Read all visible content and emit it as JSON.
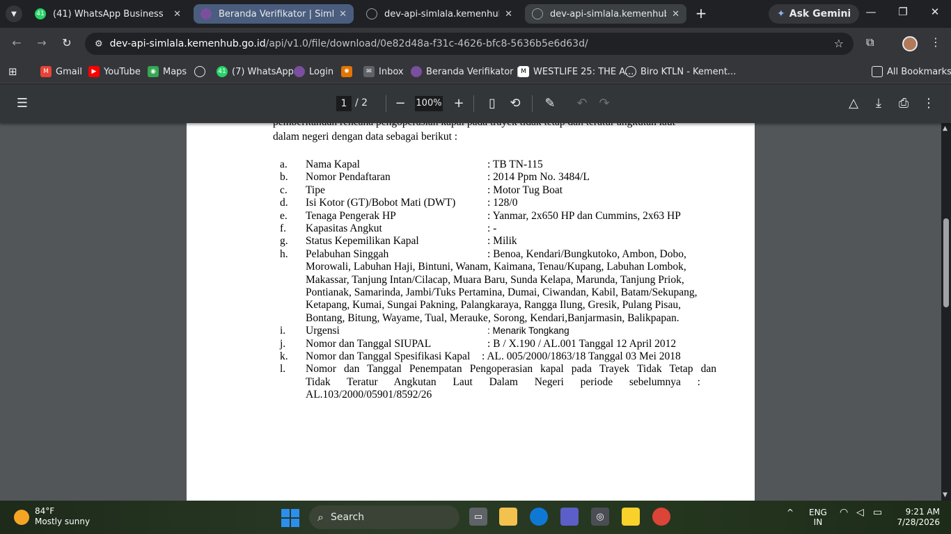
{
  "tabs": [
    {
      "title": "(41) WhatsApp Business",
      "badge": "41",
      "color": "#25d366"
    },
    {
      "title": "Beranda Verifikator | SimLala",
      "color": "#7a4f9e"
    },
    {
      "title": "dev-api-simlala.kemenhub.go.id",
      "color": "#5f6368"
    },
    {
      "title": "dev-api-simlala.kemenhub.go.id",
      "color": "#5f6368"
    }
  ],
  "gemini": "Ask Gemini",
  "url": {
    "host": "dev-api-simlala.kemenhub.go.id",
    "path": "/api/v1.0/file/download/0e82d48a-f31c-4626-bfc8-5636b5e6d63d/"
  },
  "bookmarks": [
    {
      "label": "Gmail",
      "color": "#ea4335",
      "icon": "mail-icon"
    },
    {
      "label": "YouTube",
      "color": "#ff0000",
      "icon": "youtube-icon"
    },
    {
      "label": "Maps",
      "color": "#34a853",
      "icon": "map-pin-icon"
    },
    {
      "label": "",
      "color": "#9aa0a6",
      "icon": "globe-icon"
    },
    {
      "label": "(7) WhatsApp",
      "color": "#25d366",
      "badge": "41",
      "icon": "whatsapp-icon"
    },
    {
      "label": "Login",
      "color": "#7a4f9e",
      "icon": "login-icon"
    },
    {
      "label": "",
      "color": "#e37400",
      "icon": "pinwheel-icon"
    },
    {
      "label": "Inbox",
      "color": "#5f6368",
      "icon": "inbox-icon"
    },
    {
      "label": "Beranda Verifikator |...",
      "color": "#7a4f9e",
      "icon": "simlala-icon"
    },
    {
      "label": "WESTLIFE 25: THE A...",
      "color": "#ffffff",
      "icon": "m-icon"
    },
    {
      "label": "Biro KTLN - Kement...",
      "color": "#9aa0a6",
      "icon": "globe-icon"
    }
  ],
  "all_bookmarks": "All Bookmarks",
  "pdf": {
    "page_current": "1",
    "page_total": "/  2",
    "zoom": "100%"
  },
  "document": {
    "intro_line1": "pemberitahuan rencana pengoperasian kapal pada trayek tidak tetap dan teratur angkutan laut",
    "intro_line2": "dalam negeri dengan data sebagai berikut :",
    "items": [
      {
        "letter": "a.",
        "label": "Nama Kapal",
        "value": ":   TB TN-115"
      },
      {
        "letter": "b.",
        "label": "Nomor Pendaftaran",
        "value": ":   2014 Ppm No. 3484/L"
      },
      {
        "letter": "c.",
        "label": "Tipe",
        "value": ":   Motor Tug Boat"
      },
      {
        "letter": "d.",
        "label": "Isi Kotor (GT)/Bobot Mati (DWT)",
        "value": ":   128/0"
      },
      {
        "letter": "e.",
        "label": "Tenaga Pengerak HP",
        "value": ":   Yanmar, 2x650 HP dan Cummins, 2x63 HP"
      },
      {
        "letter": "f.",
        "label": "Kapasitas Angkut",
        "value": ":    -"
      },
      {
        "letter": "g.",
        "label": "Status Kepemilikan Kapal",
        "value": ":    Milik"
      }
    ],
    "item_h": {
      "letter": "h.",
      "label": "Pelabuhan Singgah",
      "first": ":   Benoa,  Kendari/Bungkutoko,  Ambon,  Dobo,",
      "lines": [
        "Morowali, Labuhan Haji, Bintuni, Wanam, Kaimana, Tenau/Kupang, Labuhan Lombok,",
        "Makassar, Tanjung Intan/Cilacap, Muara Baru, Sunda Kelapa, Marunda, Tanjung Priok,",
        "Pontianak, Samarinda, Jambi/Tuks Pertamina, Dumai, Ciwandan, Kabil, Batam/Sekupang,",
        "Ketapang, Kumai, Sungai Pakning, Palangkaraya, Rangga Ilung, Gresik, Pulang Pisau,",
        "Bontang, Bitung, Wayame, Tual, Merauke, Sorong, Kendari,Banjarmasin, Balikpapan."
      ]
    },
    "item_i": {
      "letter": "i.",
      "label": "Urgensi",
      "value": ": Menarik Tongkang"
    },
    "item_j": {
      "letter": "j.",
      "label": "Nomor dan Tanggal SIUPAL",
      "value": ": B / X.190 / AL.001 Tanggal 12 April 2012"
    },
    "item_k": {
      "letter": "k.",
      "label": "Nomor dan Tanggal Spesifikasi Kapal",
      "value": ": AL. 005/2000/1863/18 Tanggal 03 Mei 2018"
    },
    "item_l": {
      "letter": "l.",
      "line1": "Nomor dan Tanggal Penempatan Pengoperasian kapal pada Trayek Tidak Tetap dan",
      "line2": "Tidak Teratur Angkutan Laut Dalam Negeri periode sebelumnya :",
      "line3": "AL.103/2000/05901/8592/26"
    }
  },
  "taskbar": {
    "weather_temp": "84°F",
    "weather_desc": "Mostly sunny",
    "search_placeholder": "Search",
    "lang1": "ENG",
    "lang2": "IN",
    "time": "9:21 AM",
    "date": "7/28/2026"
  }
}
